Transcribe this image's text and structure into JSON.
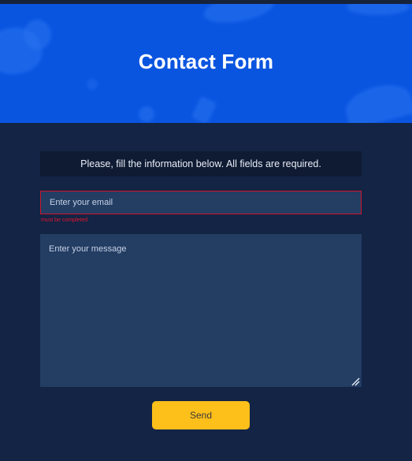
{
  "header": {
    "title": "Contact Form"
  },
  "form": {
    "notice": "Please, fill the information below. All fields are required.",
    "email": {
      "placeholder": "Enter your email",
      "value": "",
      "error": "must be completed"
    },
    "message": {
      "placeholder": "Enter your message",
      "value": ""
    },
    "send_label": "Send"
  },
  "colors": {
    "background": "#132445",
    "hero": "#0a55e0",
    "field": "#233d63",
    "error": "#d0142c",
    "button": "#fdbf1a"
  }
}
